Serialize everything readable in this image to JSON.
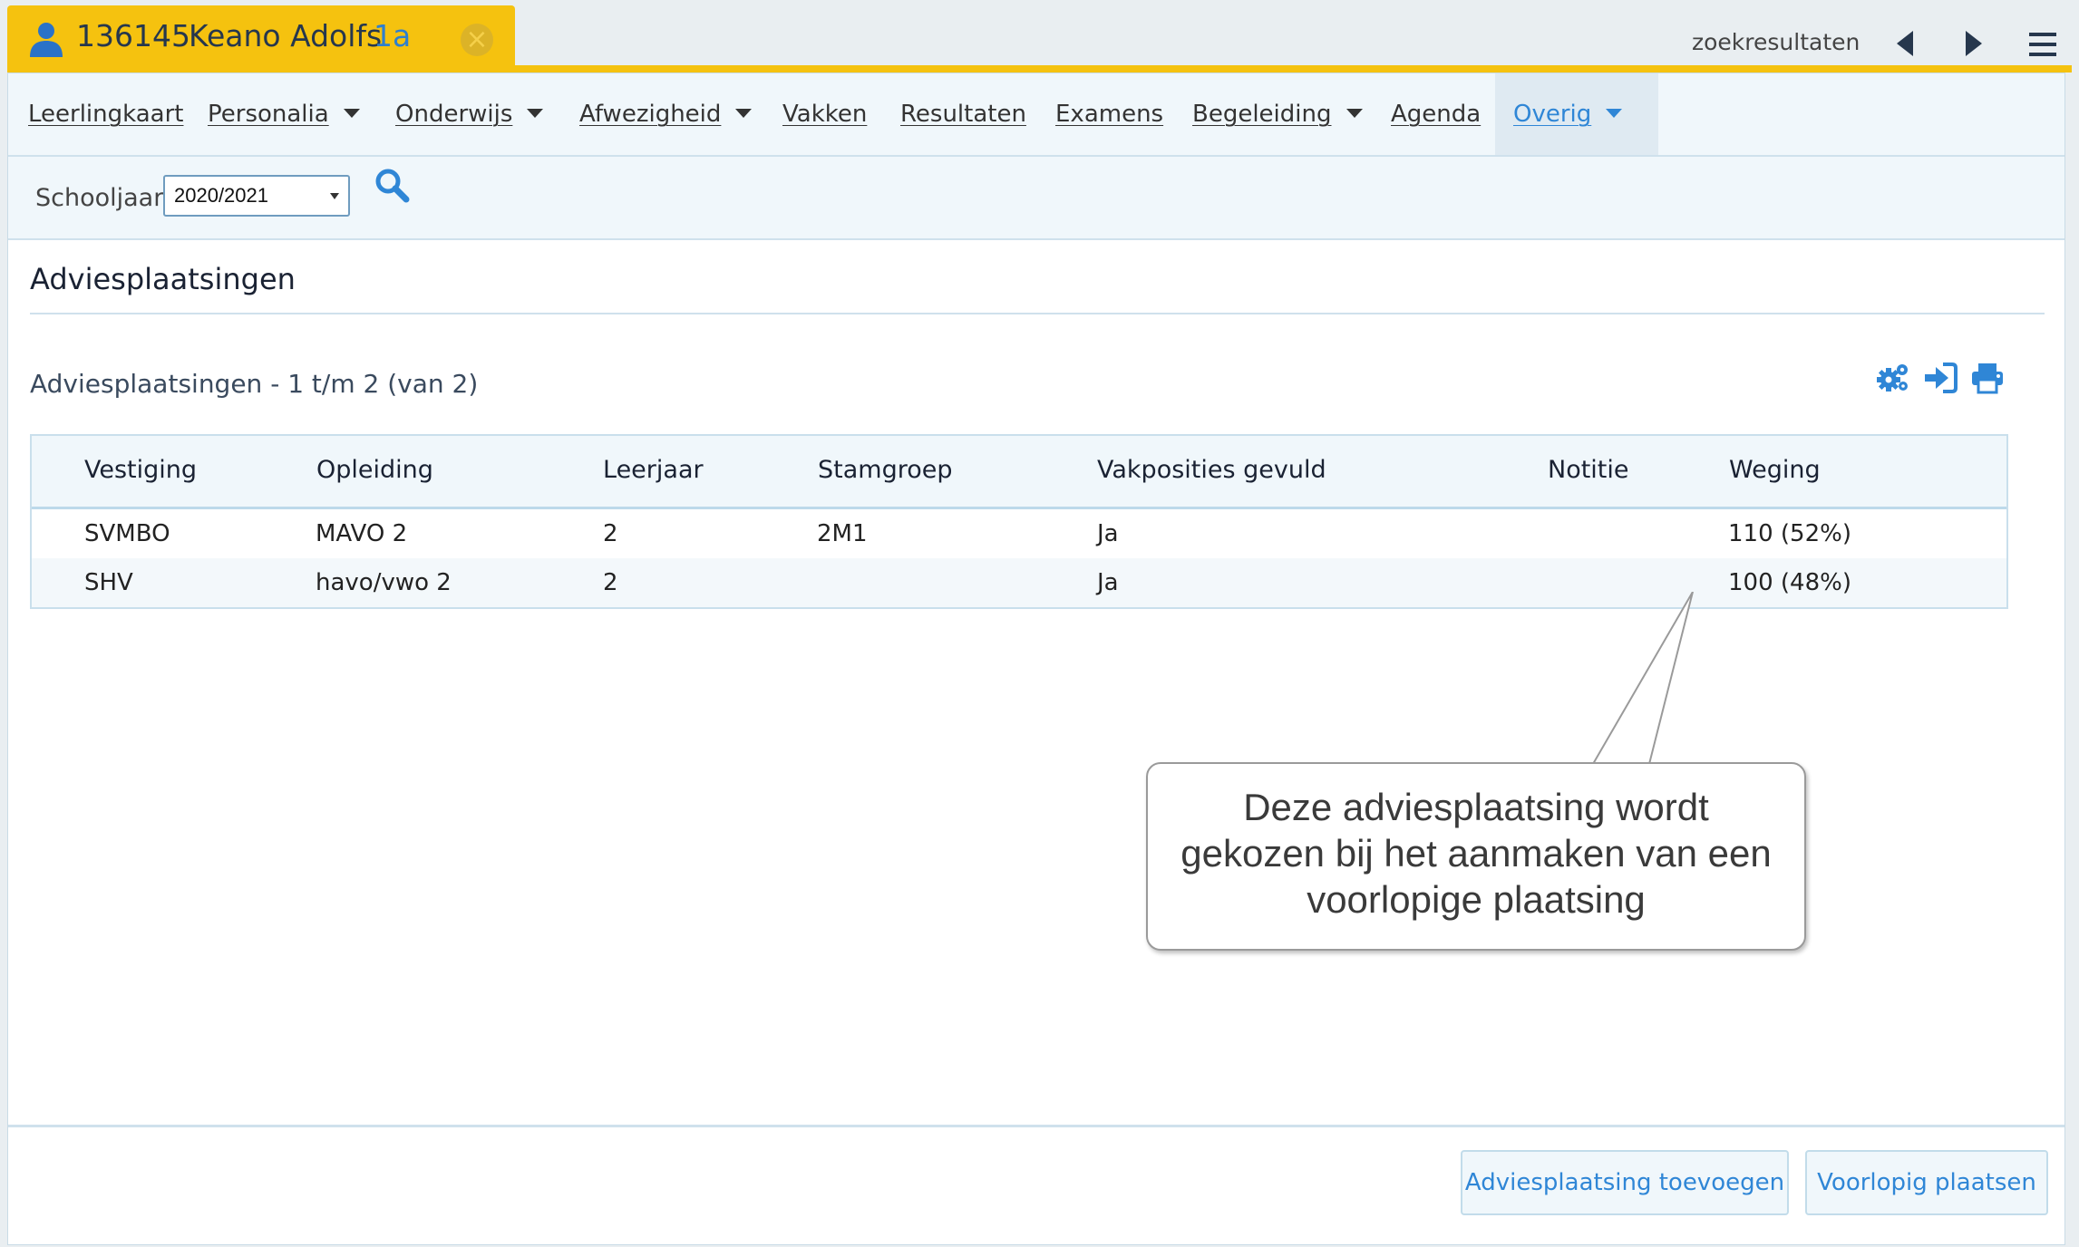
{
  "student_tab": {
    "id": "136145",
    "name": "Keano Adolfs",
    "class": "1a",
    "close_icon": "close-circle-icon"
  },
  "top_nav": {
    "search_results_label": "zoekresultaten",
    "prev_icon": "triangle-left-icon",
    "next_icon": "triangle-right-icon",
    "menu_icon": "hamburger-menu-icon"
  },
  "main_nav": [
    {
      "label": "Leerlingkaart",
      "dropdown": false
    },
    {
      "label": "Personalia",
      "dropdown": true
    },
    {
      "label": "Onderwijs",
      "dropdown": true
    },
    {
      "label": "Afwezigheid",
      "dropdown": true
    },
    {
      "label": "Vakken",
      "dropdown": false
    },
    {
      "label": "Resultaten",
      "dropdown": false
    },
    {
      "label": "Examens",
      "dropdown": false
    },
    {
      "label": "Begeleiding",
      "dropdown": true
    },
    {
      "label": "Agenda",
      "dropdown": false
    },
    {
      "label": "Overig",
      "dropdown": true,
      "active": true
    }
  ],
  "filter": {
    "label": "Schooljaar",
    "selected_year": "2020/2021",
    "search_icon": "search-icon"
  },
  "page": {
    "title": "Adviesplaatsingen",
    "list_title": "Adviesplaatsingen - 1 t/m 2 (van 2)",
    "tool_icons": [
      "settings-gears-icon",
      "sign-in-arrow-icon",
      "print-icon"
    ]
  },
  "table": {
    "columns": [
      "Vestiging",
      "Opleiding",
      "Leerjaar",
      "Stamgroep",
      "Vakposities gevuld",
      "Notitie",
      "Weging"
    ],
    "rows": [
      [
        "SVMBO",
        "MAVO 2",
        "2",
        "2M1",
        "Ja",
        "",
        "110 (52%)"
      ],
      [
        "SHV",
        "havo/vwo 2",
        "2",
        "",
        "Ja",
        "",
        "100 (48%)"
      ]
    ]
  },
  "callout": {
    "line1": "Deze adviesplaatsing wordt",
    "line2": "gekozen bij het aanmaken van een",
    "line3": "voorlopige plaatsing"
  },
  "footer": {
    "add_button": "Adviesplaatsing toevoegen",
    "place_button": "Voorlopig plaatsen"
  },
  "colors": {
    "accent_yellow": "#f5c20f",
    "link_blue": "#2f86d6",
    "panel_tint": "#f0f7fb"
  }
}
